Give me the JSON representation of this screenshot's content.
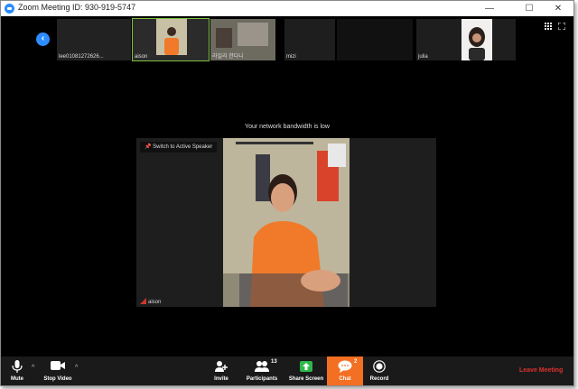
{
  "window": {
    "title": "Zoom Meeting ID: 930-919-5747",
    "controls": {
      "minimize": "—",
      "maximize": "☐",
      "close": "✕"
    }
  },
  "participants_strip": {
    "thumbnails": [
      {
        "name": "lee01081272626..."
      },
      {
        "name": "aison"
      },
      {
        "name": "라일리 한다니"
      },
      {
        "name": "mizi"
      },
      {
        "name": ""
      },
      {
        "name": "julia"
      }
    ]
  },
  "notice": "Your network bandwidth is low",
  "main_video": {
    "pin_label": "Switch to Active Speaker",
    "speaker_name": "aison"
  },
  "toolbar": {
    "mute": "Mute",
    "stop_video": "Stop Video",
    "invite": "Invite",
    "participants": "Participants",
    "participants_count": "13",
    "share_screen": "Share Screen",
    "chat": "Chat",
    "chat_count": "2",
    "record": "Record",
    "leave": "Leave Meeting"
  },
  "colors": {
    "accent": "#2d8cff",
    "chat_active": "#f36f21",
    "leave": "#e0312e",
    "share": "#2eb84b",
    "active_outline": "#7fbf3c"
  }
}
